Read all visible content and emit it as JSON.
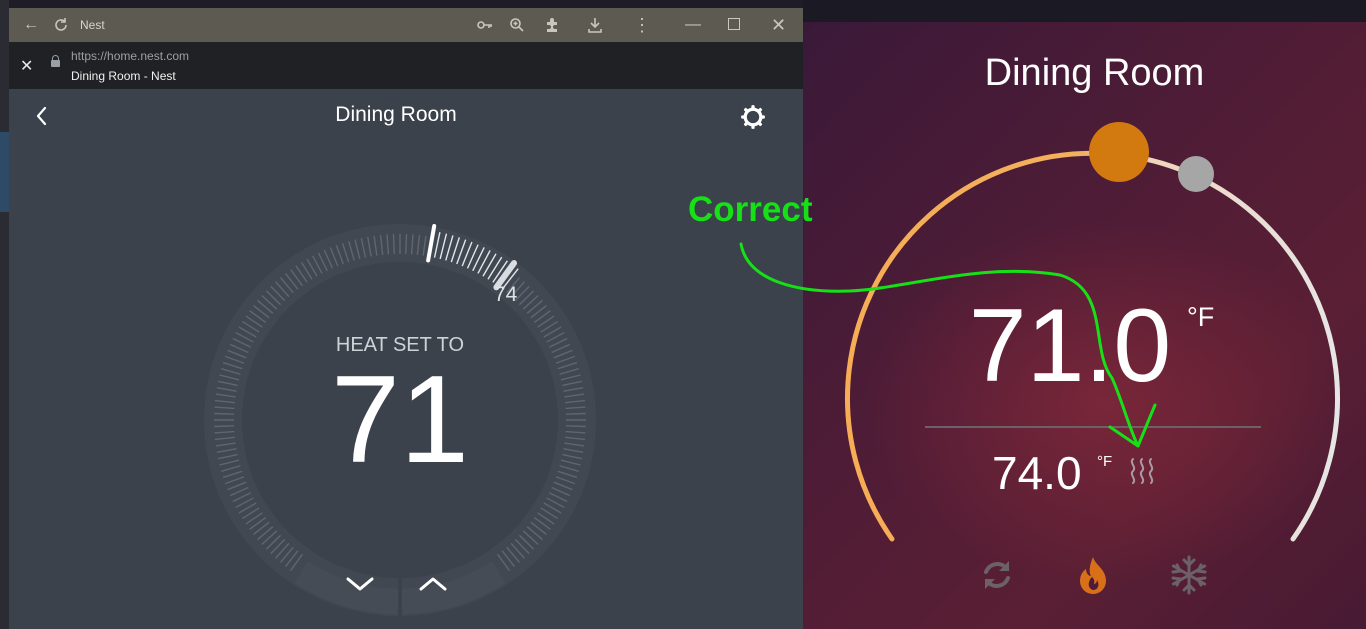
{
  "browser": {
    "tab_title": "Nest",
    "url": "https://home.nest.com",
    "page_title": "Dining Room - Nest"
  },
  "nest": {
    "room_title": "Dining Room",
    "mode_label": "HEAT SET TO",
    "setpoint": "71",
    "current_temp_label": "74"
  },
  "thermostat_card": {
    "room_title": "Dining Room",
    "current_temp": "71.0",
    "current_unit": "°F",
    "setpoint_temp": "74.0",
    "setpoint_unit": "°F",
    "active_mode": "heat",
    "modes": [
      "auto-icon",
      "flame-icon",
      "snowflake-icon"
    ],
    "colors": {
      "arc_warm": "#f6ad55",
      "handle_orange": "#d27a10",
      "flame": "#d8701a",
      "arc_cool": "#e6e6e6"
    }
  },
  "annotation": {
    "label": "Correct",
    "color": "#16e016"
  }
}
